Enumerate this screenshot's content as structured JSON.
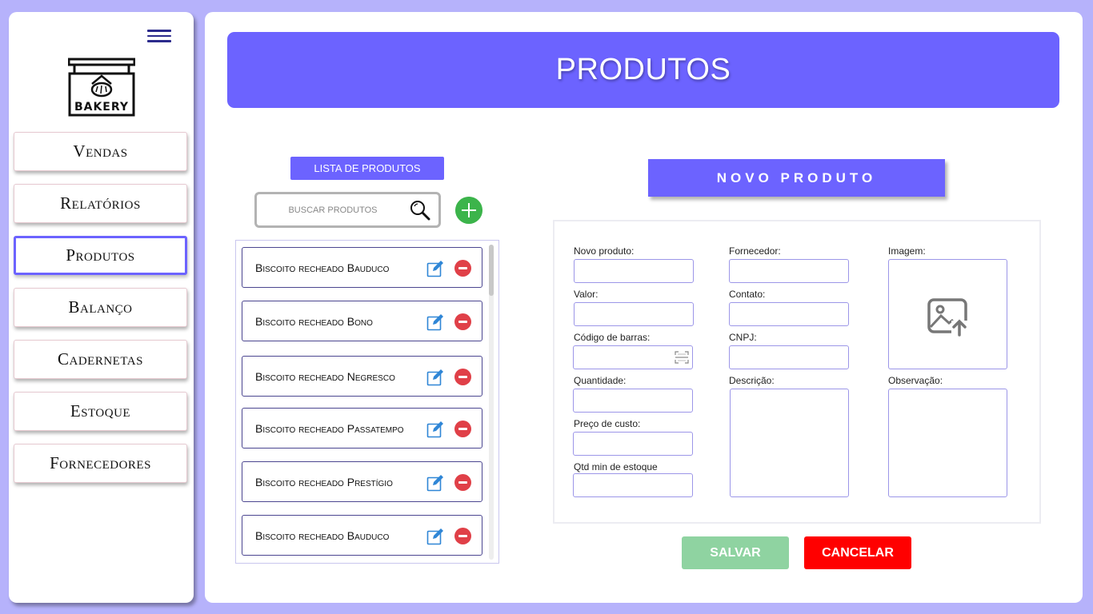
{
  "sidebar": {
    "logo_text": "BAKERY",
    "items": [
      {
        "label": "Vendas",
        "active": false
      },
      {
        "label": "Relatórios",
        "active": false
      },
      {
        "label": "Produtos",
        "active": true
      },
      {
        "label": "Balanço",
        "active": false
      },
      {
        "label": "Cadernetas",
        "active": false
      },
      {
        "label": "Estoque",
        "active": false
      },
      {
        "label": "Fornecedores",
        "active": false
      }
    ]
  },
  "header": {
    "title": "PRODUTOS"
  },
  "list": {
    "title": "LISTA DE PRODUTOS",
    "search_placeholder": "BUSCAR PRODUTOS",
    "items": [
      "Biscoito recheado Bauduco",
      "Biscoito recheado Bono",
      "Biscoito recheado Negresco",
      "Biscoito recheado Passatempo",
      "Biscoito recheado Prestígio",
      "Biscoito recheado Bauduco"
    ]
  },
  "form": {
    "title": "NOVO PRODUTO",
    "labels": {
      "novo_produto": "Novo produto:",
      "valor": "Valor:",
      "codigo_barras": "Código de barras:",
      "quantidade": "Quantidade:",
      "preco_custo": "Preço de custo:",
      "qtd_min": "Qtd min de estoque",
      "fornecedor": "Fornecedor:",
      "contato": "Contato:",
      "cnpj": "CNPJ:",
      "descricao": "Descrição:",
      "imagem": "Imagem:",
      "observacao": "Observação:"
    },
    "save_label": "SALVAR",
    "cancel_label": "CANCELAR"
  },
  "colors": {
    "accent": "#6c63ff",
    "background": "#b6b2fb",
    "add": "#3cb44b",
    "delete": "#e04048",
    "save": "#8fd3a1",
    "cancel": "#ff0000"
  }
}
